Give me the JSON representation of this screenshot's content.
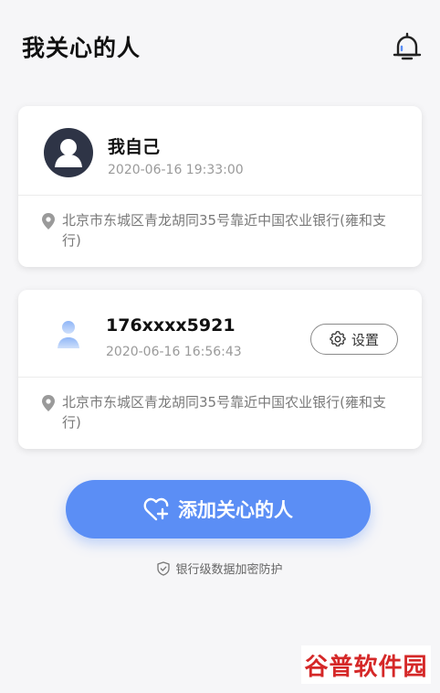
{
  "header": {
    "title": "我关心的人"
  },
  "contacts": [
    {
      "name": "我自己",
      "time": "2020-06-16 19:33:00",
      "address": "北京市东城区青龙胡同35号靠近中国农业银行(雍和支行)"
    },
    {
      "name": "176xxxx5921",
      "time": "2020-06-16 16:56:43",
      "settings_label": "设置",
      "address": "北京市东城区青龙胡同35号靠近中国农业银行(雍和支行)"
    }
  ],
  "add_button": {
    "label": "添加关心的人"
  },
  "security": {
    "text": "银行级数据加密防护"
  },
  "watermark": {
    "text": "谷普软件园"
  },
  "colors": {
    "primary": "#5b8ef5",
    "avatar_dark": "#2e3446",
    "watermark_red": "#d52828"
  }
}
